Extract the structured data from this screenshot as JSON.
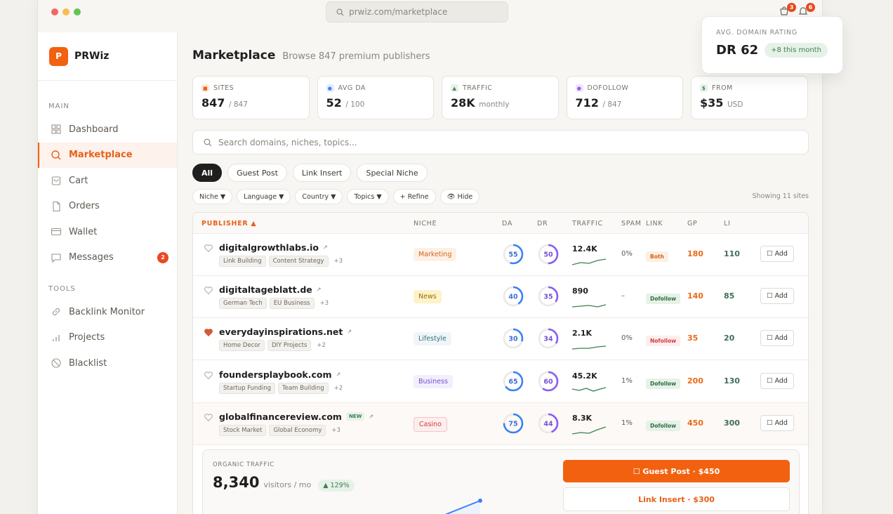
{
  "browser": {
    "url": "prwiz.com/marketplace",
    "cart_count": "3",
    "notif_count": "6"
  },
  "brand": {
    "logo": "P",
    "name": "PRWiz"
  },
  "sidebar": {
    "main_label": "MAIN",
    "tools_label": "TOOLS",
    "items": [
      {
        "label": "Dashboard"
      },
      {
        "label": "Marketplace"
      },
      {
        "label": "Cart"
      },
      {
        "label": "Orders"
      },
      {
        "label": "Wallet"
      },
      {
        "label": "Messages",
        "badge": "2"
      }
    ],
    "tools": [
      {
        "label": "Backlink Monitor"
      },
      {
        "label": "Projects"
      },
      {
        "label": "Blacklist"
      }
    ]
  },
  "page": {
    "title": "Marketplace",
    "subtitle": "Browse 847 premium publishers"
  },
  "stats": [
    {
      "label": "SITES",
      "value": "847",
      "unit": "/ 847",
      "color": "#f2610f"
    },
    {
      "label": "AVG DA",
      "value": "52",
      "unit": "/ 100",
      "color": "#3b82f6"
    },
    {
      "label": "TRAFFIC",
      "value": "28K",
      "unit": "monthly",
      "color": "#3d7f52"
    },
    {
      "label": "DOFOLLOW",
      "value": "712",
      "unit": "/ 847",
      "color": "#8b5cf6"
    },
    {
      "label": "FROM",
      "value": "$35",
      "unit": "USD",
      "color": "#3d7f52"
    }
  ],
  "search": {
    "placeholder": "Search domains, niches, topics..."
  },
  "chips": [
    "All",
    "Guest Post",
    "Link Insert",
    "Special Niche"
  ],
  "filters": [
    "Niche ▼",
    "Language ▼",
    "Country ▼",
    "Topics ▼",
    "+ Refine",
    "👁 Hide"
  ],
  "showing": "Showing 11 sites",
  "columns": {
    "publisher": "PUBLISHER ▲",
    "niche": "NICHE",
    "da": "DA",
    "dr": "DR",
    "traffic": "TRAFFIC",
    "spam": "SPAM",
    "link": "LINK",
    "gp": "GP",
    "li": "LI"
  },
  "rows": [
    {
      "domain": "digitalgrowthlabs.io",
      "new": "",
      "fav": false,
      "tags": [
        "Link Building",
        "Content Strategy"
      ],
      "more": "+3",
      "niche": "Marketing",
      "da": 55,
      "dr": 50,
      "traffic": "12.4K",
      "spam": "0%",
      "link": "Both",
      "gp": "180",
      "li": "110",
      "add": "Add"
    },
    {
      "domain": "digitaltageblatt.de",
      "new": "",
      "fav": false,
      "tags": [
        "German Tech",
        "EU Business"
      ],
      "more": "+3",
      "niche": "News",
      "da": 40,
      "dr": 35,
      "traffic": "890",
      "spam": "–",
      "link": "Dofollow",
      "gp": "140",
      "li": "85",
      "add": "Add"
    },
    {
      "domain": "everydayinspirations.net",
      "new": "",
      "fav": true,
      "tags": [
        "Home Decor",
        "DIY Projects"
      ],
      "more": "+2",
      "niche": "Lifestyle",
      "da": 30,
      "dr": 34,
      "traffic": "2.1K",
      "spam": "0%",
      "link": "Nofollow",
      "gp": "35",
      "li": "20",
      "add": "Add"
    },
    {
      "domain": "foundersplaybook.com",
      "new": "",
      "fav": false,
      "tags": [
        "Startup Funding",
        "Team Building"
      ],
      "more": "+2",
      "niche": "Business",
      "da": 65,
      "dr": 60,
      "traffic": "45.2K",
      "spam": "1%",
      "link": "Dofollow",
      "gp": "200",
      "li": "130",
      "add": "Add"
    },
    {
      "domain": "globalfinancereview.com",
      "new": "NEW",
      "fav": false,
      "tags": [
        "Stock Market",
        "Global Economy"
      ],
      "more": "+3",
      "niche": "Casino",
      "da": 75,
      "dr": 44,
      "traffic": "8.3K",
      "spam": "1%",
      "link": "Dofollow",
      "gp": "450",
      "li": "300",
      "add": "Add"
    }
  ],
  "expanded": {
    "label": "ORGANIC TRAFFIC",
    "value": "8,340",
    "unit": "visitors / mo",
    "change": "▲ 129%",
    "gp_button": "☐ Guest Post · $450",
    "li_button": "Link Insert · $300"
  },
  "popup": {
    "label": "AVG. DOMAIN RATING",
    "value": "DR 62",
    "change": "+8 this month"
  }
}
